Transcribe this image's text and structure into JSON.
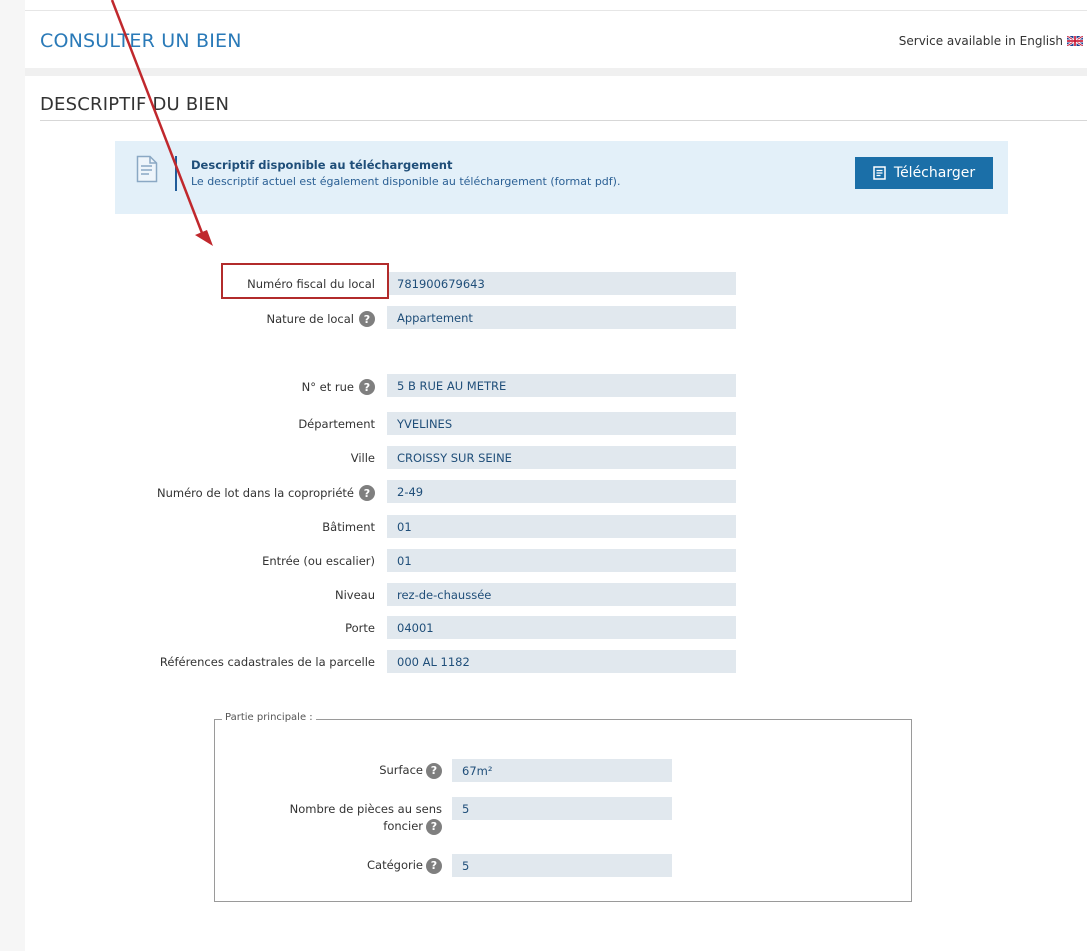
{
  "header": {
    "title": "CONSULTER UN BIEN",
    "english_link": "Service available in English",
    "flag_icon": "uk-flag-icon"
  },
  "section": {
    "title": "DESCRIPTIF DU BIEN"
  },
  "download": {
    "title": "Descriptif disponible au téléchargement",
    "description": "Le descriptif actuel est également disponible au téléchargement (format pdf).",
    "button_label": "Télécharger",
    "icon": "document-icon"
  },
  "fields": {
    "numero_fiscal": {
      "label": "Numéro fiscal du local",
      "value": "781900679643"
    },
    "nature": {
      "label": "Nature de local",
      "value": "Appartement"
    },
    "rue": {
      "label": "N° et rue",
      "value": "5 B RUE AU METRE"
    },
    "departement": {
      "label": "Département",
      "value": "YVELINES"
    },
    "ville": {
      "label": "Ville",
      "value": "CROISSY SUR SEINE"
    },
    "lot": {
      "label": "Numéro de lot dans la copropriété",
      "value": "2-49"
    },
    "batiment": {
      "label": "Bâtiment",
      "value": "01"
    },
    "entree": {
      "label": "Entrée (ou escalier)",
      "value": "01"
    },
    "niveau": {
      "label": "Niveau",
      "value": "rez-de-chaussée"
    },
    "porte": {
      "label": "Porte",
      "value": "04001"
    },
    "cadastre": {
      "label": "Références cadastrales de la parcelle",
      "value": "000 AL 1182"
    }
  },
  "partie_principale": {
    "legend": "Partie principale :",
    "surface": {
      "label": "Surface",
      "value": "67m²"
    },
    "pieces": {
      "label_line1": "Nombre de pièces au sens",
      "label_line2": "foncier",
      "value": "5"
    },
    "categorie": {
      "label": "Catégorie",
      "value": "5"
    }
  },
  "help_glyph": "?",
  "colors": {
    "accent_blue": "#2a7ab8",
    "button_blue": "#1b6fa8",
    "info_background": "#e3f0f9",
    "value_background": "#e1e8ee",
    "annotation_red": "#b22b2b"
  }
}
